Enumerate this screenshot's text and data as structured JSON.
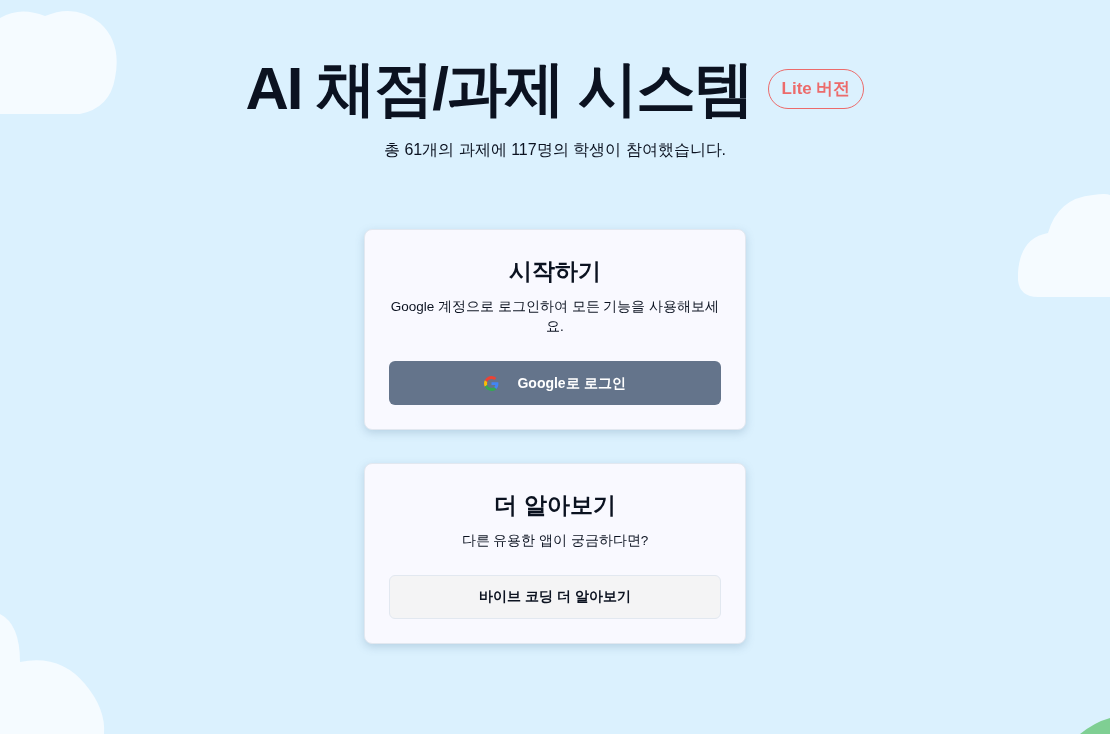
{
  "header": {
    "title": "AI 채점/과제 시스템",
    "badge": "Lite 버전",
    "subtitle": "총 61개의 과제에 117명의 학생이 참여했습니다."
  },
  "cards": [
    {
      "title": "시작하기",
      "description": "Google 계정으로 로그인하여 모든 기능을 사용해보세요.",
      "button": {
        "label": "Google로 로그인",
        "kind": "google"
      }
    },
    {
      "title": "더 알아보기",
      "description": "다른 유용한 앱이 궁금하다면?",
      "button": {
        "label": "바이브 코딩 더 알아보기",
        "kind": "plain"
      }
    }
  ]
}
